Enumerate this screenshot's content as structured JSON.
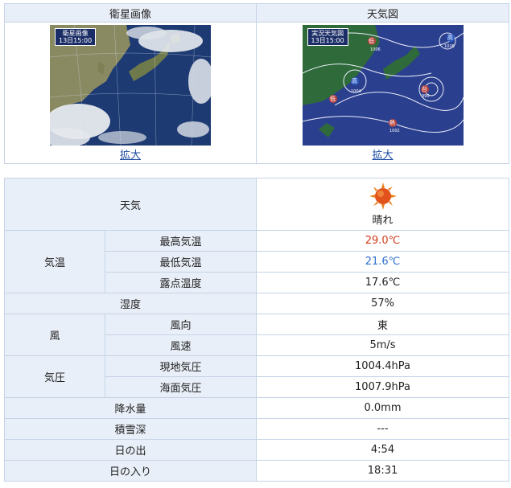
{
  "maps": {
    "satellite": {
      "header": "衛星画像",
      "image_label_line1": "衛星画像",
      "image_label_line2": "13日15:00",
      "zoom_link": "拡大"
    },
    "weather_chart": {
      "header": "天気図",
      "image_label_line1": "実況天気図",
      "image_label_line2": "13日15:00",
      "zoom_link": "拡大",
      "map_marks": {
        "low1": "低",
        "low2": "低",
        "high1": "高",
        "high2": "高",
        "typhoon": "台",
        "heat": "熱",
        "p1": "1006",
        "p2": "1004",
        "p3": "1002",
        "p4": "990",
        "p5": "1026"
      }
    }
  },
  "weather": {
    "weather": {
      "label": "天気",
      "value": "晴れ",
      "icon": "sunny-icon"
    },
    "temperature": {
      "group_label": "気温",
      "max": {
        "label": "最高気温",
        "value": "29.0℃"
      },
      "min": {
        "label": "最低気温",
        "value": "21.6℃"
      },
      "dew": {
        "label": "露点温度",
        "value": "17.6℃"
      }
    },
    "humidity": {
      "label": "湿度",
      "value": "57%"
    },
    "wind": {
      "group_label": "風",
      "direction": {
        "label": "風向",
        "value": "東"
      },
      "speed": {
        "label": "風速",
        "value": "5m/s"
      }
    },
    "pressure": {
      "group_label": "気圧",
      "station": {
        "label": "現地気圧",
        "value": "1004.4hPa"
      },
      "sea": {
        "label": "海面気圧",
        "value": "1007.9hPa"
      }
    },
    "precipitation": {
      "label": "降水量",
      "value": "0.0mm"
    },
    "snow_depth": {
      "label": "積雪深",
      "value": "---"
    },
    "sunrise": {
      "label": "日の出",
      "value": "4:54"
    },
    "sunset": {
      "label": "日の入り",
      "value": "18:31"
    }
  },
  "colors": {
    "header_bg": "#e9eff8",
    "border": "#c5d3e6",
    "max_temp": "#cf3d1c",
    "min_temp": "#2f6fd0",
    "link": "#1f4ea3"
  }
}
